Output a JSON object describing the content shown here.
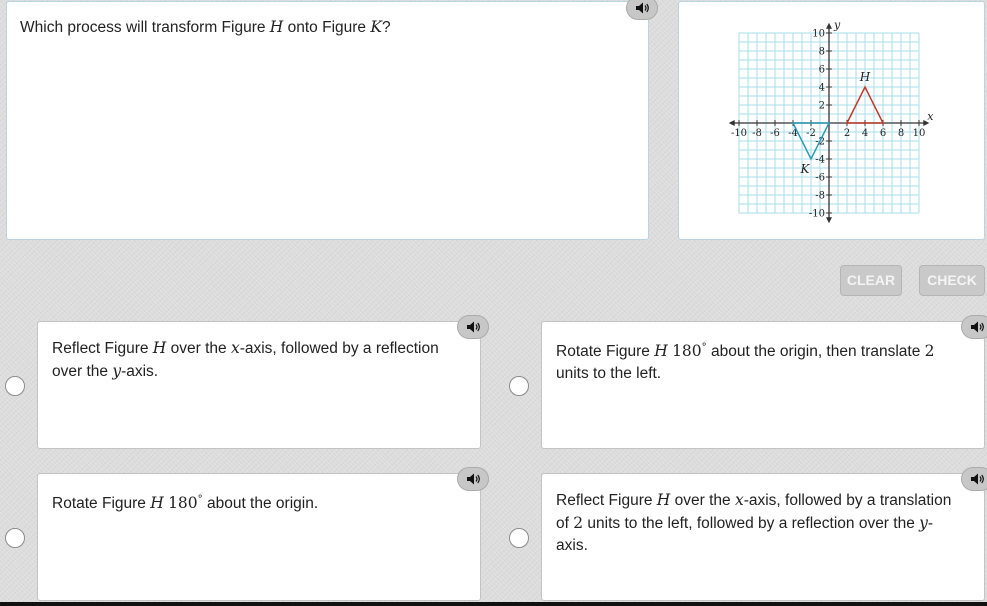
{
  "question": {
    "prefix": "Which process will transform Figure ",
    "fig1": "H",
    "middle": " onto Figure ",
    "fig2": "K",
    "suffix": "?"
  },
  "controls": {
    "clear_label": "CLEAR",
    "check_label": "CHECK"
  },
  "graph": {
    "x_axis_label": "x",
    "y_axis_label": "y",
    "x_tick_labels": [
      "-10",
      "-8",
      "-6",
      "-4",
      "-2",
      "2",
      "4",
      "6",
      "8",
      "10"
    ],
    "y_tick_labels": [
      "10",
      "8",
      "6",
      "4",
      "2",
      "-2",
      "-4",
      "-6",
      "-8",
      "-10"
    ],
    "figure_h": {
      "label": "H",
      "color": "#c0392b",
      "vertices": [
        [
          2,
          0
        ],
        [
          4,
          4
        ],
        [
          6,
          0
        ]
      ]
    },
    "figure_k": {
      "label": "K",
      "color": "#2a9bb5",
      "vertices": [
        [
          -4,
          0
        ],
        [
          -2,
          -4
        ],
        [
          0,
          0
        ]
      ]
    },
    "grid_color": "#a9dcee"
  },
  "choices": [
    {
      "id": "a",
      "parts": [
        "Reflect Figure ",
        "H",
        " over the ",
        "x",
        "-axis, followed by a reflection over the ",
        "y",
        "-axis."
      ]
    },
    {
      "id": "b",
      "parts": [
        "Rotate Figure ",
        "H",
        " ",
        "180",
        "°",
        " about the origin, then translate ",
        "2",
        " units to the left."
      ]
    },
    {
      "id": "c",
      "parts": [
        "Rotate Figure ",
        "H",
        " ",
        "180",
        "°",
        " about the origin."
      ]
    },
    {
      "id": "d",
      "parts": [
        "Reflect Figure ",
        "H",
        " over the ",
        "x",
        "-axis, followed by a translation of ",
        "2",
        " units to the left, followed by a reflection over the ",
        "y",
        "-axis."
      ]
    }
  ]
}
